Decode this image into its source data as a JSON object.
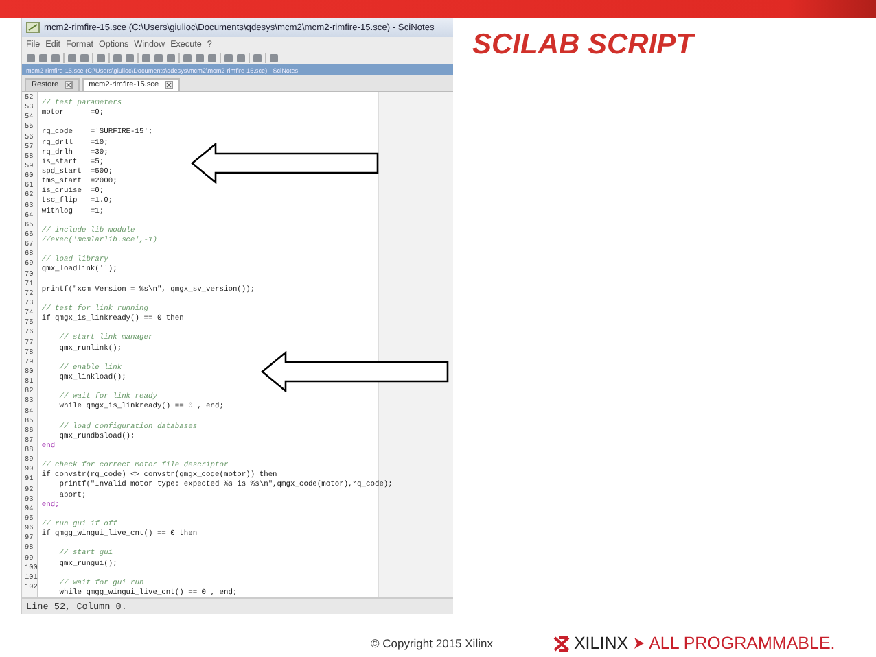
{
  "slide": {
    "title": "SCILAB SCRIPT",
    "copyright": "© Copyright 2015 Xilinx",
    "logo": {
      "brand": "XILINX",
      "tagline": "ALL PROGRAMMABLE."
    }
  },
  "window": {
    "title": "mcm2-rimfire-15.sce (C:\\Users\\giulioc\\Documents\\qdesys\\mcm2\\mcm2-rimfire-15.sce) - SciNotes",
    "menu": [
      "File",
      "Edit",
      "Format",
      "Options",
      "Window",
      "Execute",
      "?"
    ],
    "docked_title": "mcm2-rimfire-15.sce (C:\\Users\\giulioc\\Documents\\qdesys\\mcm2\\mcm2-rimfire-15.sce) - SciNotes",
    "tabs": [
      {
        "label": "Restore",
        "selected": false
      },
      {
        "label": "mcm2-rimfire-15.sce",
        "selected": true
      }
    ],
    "status_bar": "Line 52, Column 0."
  },
  "editor": {
    "lines": [
      {
        "number": "52",
        "kind": "comment",
        "text": "// test parameters"
      },
      {
        "number": "53",
        "kind": "code",
        "text": "motor      =0;"
      },
      {
        "number": "54"
      },
      {
        "number": "55",
        "kind": "code",
        "text": "rq_code    ='SURFIRE-15';"
      },
      {
        "number": "56",
        "kind": "code",
        "text": "rq_drll    =10;"
      },
      {
        "number": "57",
        "kind": "code",
        "text": "rq_drlh    =30;"
      },
      {
        "number": "58",
        "kind": "code",
        "text": "is_start   =5;"
      },
      {
        "number": "59",
        "kind": "code",
        "text": "spd_start  =500;"
      },
      {
        "number": "60",
        "kind": "code",
        "text": "tms_start  =2000;"
      },
      {
        "number": "61",
        "kind": "code",
        "text": "is_cruise  =0;"
      },
      {
        "number": "62",
        "kind": "code",
        "text": "tsc_flip   =1.0;"
      },
      {
        "number": "63",
        "kind": "code",
        "text": "withlog    =1;"
      },
      {
        "number": "64"
      },
      {
        "number": "65",
        "kind": "comment",
        "text": "// include lib module"
      },
      {
        "number": "66",
        "kind": "comment",
        "text": "//exec('mcmlarlib.sce',-1)"
      },
      {
        "number": "67"
      },
      {
        "number": "68",
        "kind": "comment",
        "text": "// load library"
      },
      {
        "number": "69",
        "kind": "code",
        "text": "qmx_loadlink('');"
      },
      {
        "number": "70"
      },
      {
        "number": "71",
        "kind": "code",
        "text": "printf(\"xcm Version = %s\\n\", qmgx_sv_version());"
      },
      {
        "number": "72"
      },
      {
        "number": "73",
        "kind": "comment",
        "text": "// test for link running"
      },
      {
        "number": "74",
        "kind": "code",
        "text": "if qmgx_is_linkready() == 0 then"
      },
      {
        "number": "75"
      },
      {
        "number": "76",
        "kind": "comment",
        "text": "    // start link manager"
      },
      {
        "number": "77",
        "kind": "code",
        "text": "    qmx_runlink();"
      },
      {
        "number": "78"
      },
      {
        "number": "79",
        "kind": "comment",
        "text": "    // enable link"
      },
      {
        "number": "80",
        "kind": "code",
        "text": "    qmx_linkload();"
      },
      {
        "number": "81"
      },
      {
        "number": "82",
        "kind": "comment",
        "text": "    // wait for link ready"
      },
      {
        "number": "83",
        "kind": "code",
        "text": "    while qmgx_is_linkready() == 0 , end;"
      },
      {
        "number": "84"
      },
      {
        "number": "85",
        "kind": "comment",
        "text": "    // load configuration databases"
      },
      {
        "number": "86",
        "kind": "code",
        "text": "    qmx_rundbsload();"
      },
      {
        "number": "87",
        "kind": "keyword",
        "text": "end"
      },
      {
        "number": "88"
      },
      {
        "number": "89",
        "kind": "comment",
        "text": "// check for correct motor file descriptor"
      },
      {
        "number": "90",
        "kind": "code",
        "text": "if convstr(rq_code) <> convstr(qmgx_code(motor)) then"
      },
      {
        "number": "91",
        "kind": "code",
        "text": "    printf(\"Invalid motor type: expected %s is %s\\n\",qmgx_code(motor),rq_code);"
      },
      {
        "number": "92",
        "kind": "code",
        "text": "    abort;"
      },
      {
        "number": "93",
        "kind": "keyword",
        "text": "end;"
      },
      {
        "number": "94"
      },
      {
        "number": "95",
        "kind": "comment",
        "text": "// run gui if off"
      },
      {
        "number": "96",
        "kind": "code",
        "text": "if qmgg_wingui_live_cnt() == 0 then"
      },
      {
        "number": "97"
      },
      {
        "number": "98",
        "kind": "comment",
        "text": "    // start gui"
      },
      {
        "number": "99",
        "kind": "code",
        "text": "    qmx_rungui();"
      },
      {
        "number": "100"
      },
      {
        "number": "101",
        "kind": "comment",
        "text": "    // wait for gui run"
      },
      {
        "number": "102",
        "kind": "code",
        "text": "    while qmgg_wingui_live_cnt() == 0 , end;"
      }
    ]
  }
}
